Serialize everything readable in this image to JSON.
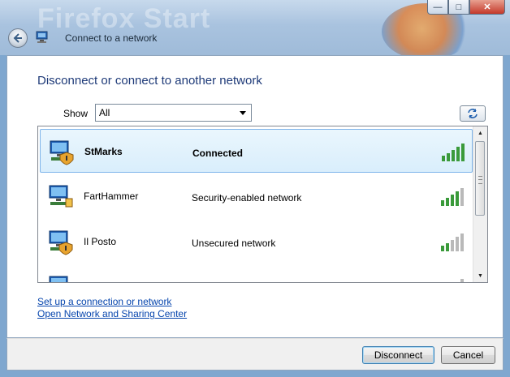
{
  "window": {
    "title": "Connect to a network",
    "background_ghost_text": "Firefox Start",
    "minimize_glyph": "—",
    "maximize_glyph": "□",
    "close_glyph": "✕"
  },
  "main": {
    "heading": "Disconnect or connect to another network",
    "show_label": "Show",
    "filter_value": "All",
    "refresh_icon": "refresh-arrows-icon"
  },
  "networks": [
    {
      "name": "StMarks",
      "status": "Connected",
      "selected": true,
      "signal_bars": 5,
      "icon": "secured-network-icon"
    },
    {
      "name": "FartHammer",
      "status": "Security-enabled network",
      "selected": false,
      "signal_bars": 4,
      "icon": "secured-network-icon"
    },
    {
      "name": "Il Posto",
      "status": "Unsecured network",
      "selected": false,
      "signal_bars": 2,
      "icon": "unsecured-network-icon"
    }
  ],
  "links": {
    "setup": "Set up a connection or network",
    "sharing_center": "Open Network and Sharing Center"
  },
  "buttons": {
    "disconnect": "Disconnect",
    "cancel": "Cancel"
  },
  "colors": {
    "heading": "#1e3a78",
    "link": "#0645ad",
    "signal_active": "#3a9a3a",
    "signal_inactive": "#b9b9b9",
    "selection": "#d9eefc"
  }
}
